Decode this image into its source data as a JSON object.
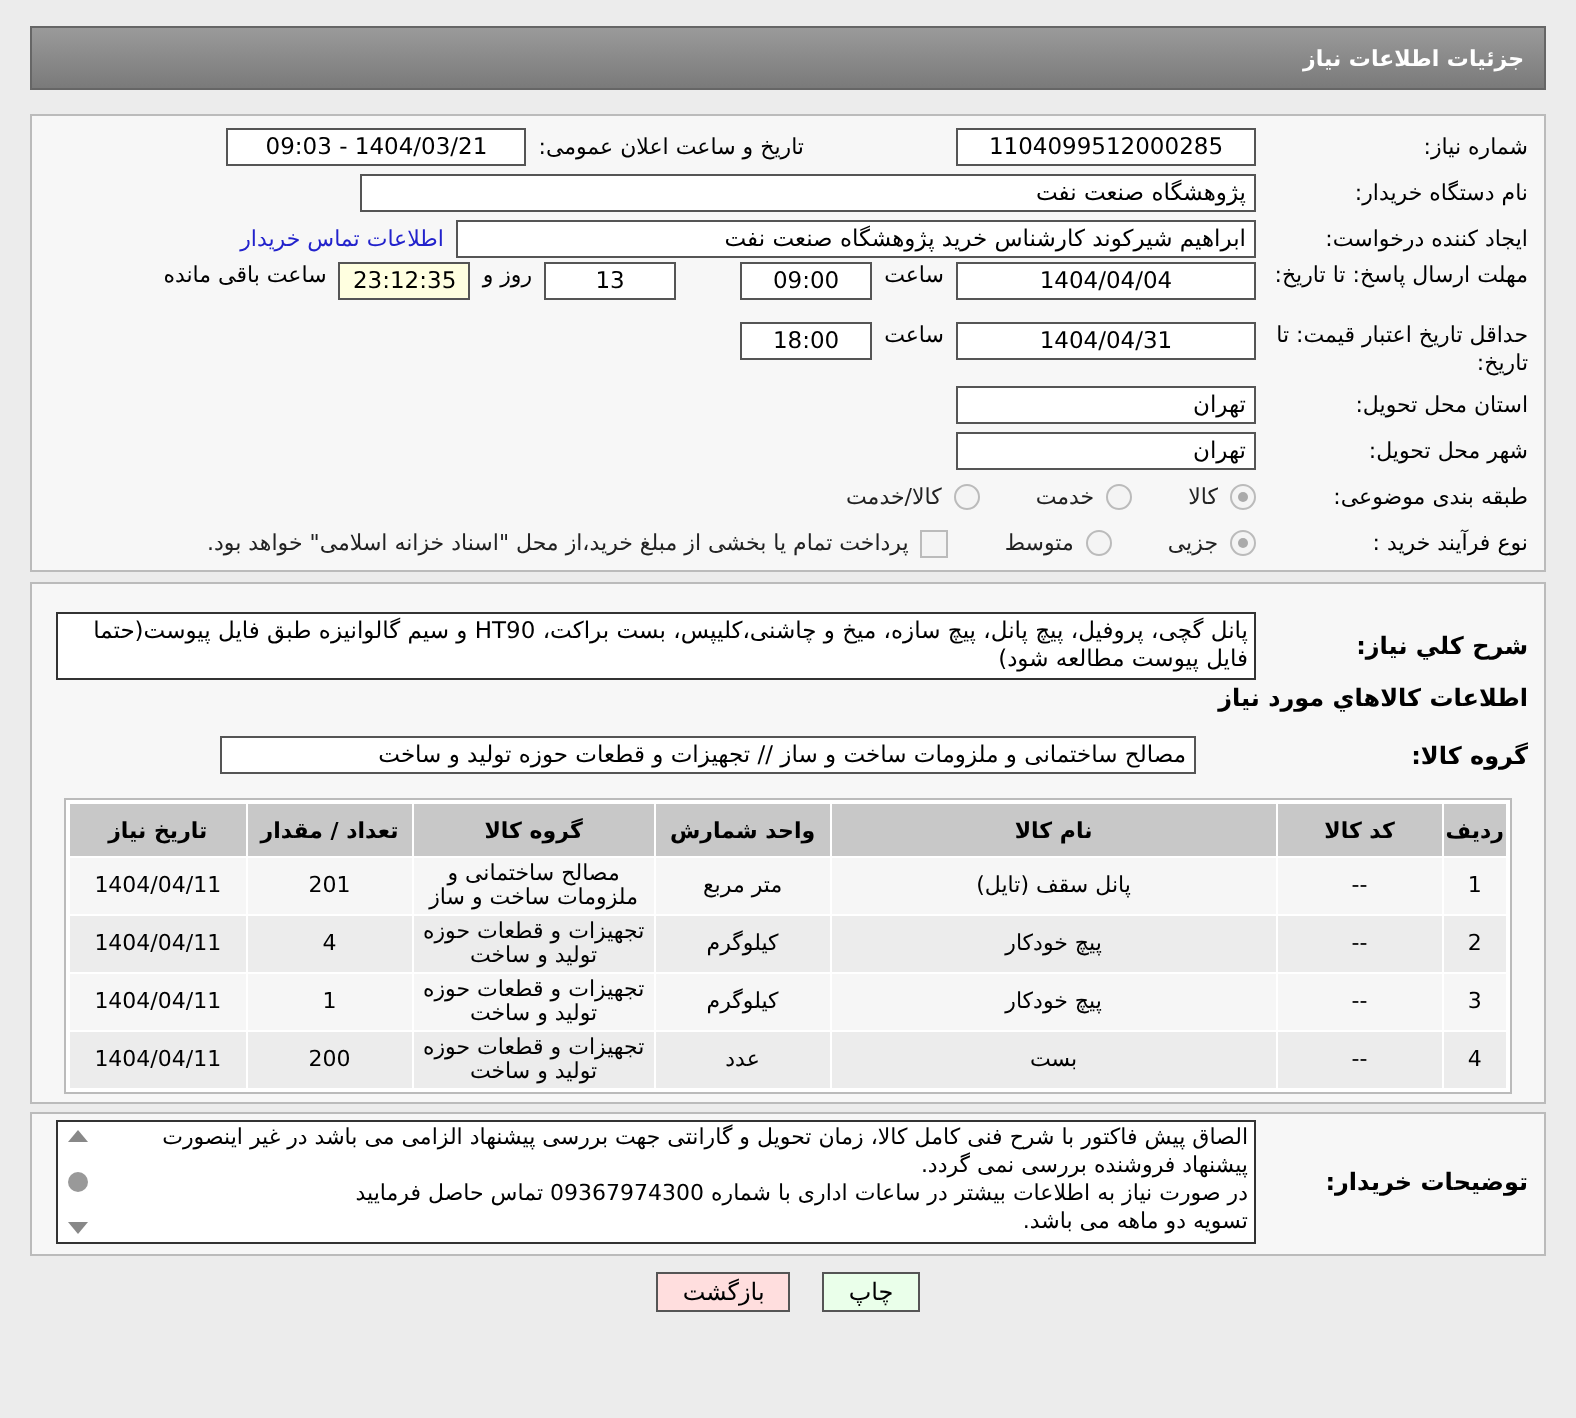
{
  "header": {
    "title": "جزئیات اطلاعات نیاز"
  },
  "need_number": {
    "label": "شماره نیاز:",
    "value": "1104099512000285"
  },
  "announce": {
    "label": "تاریخ و ساعت اعلان عمومی:",
    "value": "1404/03/21 - 09:03"
  },
  "buyer_org": {
    "label": "نام دستگاه خریدار:",
    "value": "پژوهشگاه صنعت نفت"
  },
  "creator": {
    "label": "ایجاد کننده درخواست:",
    "value": "ابراهیم شیرکوند کارشناس خرید پژوهشگاه صنعت نفت",
    "link": "اطلاعات تماس خریدار"
  },
  "reply_deadline": {
    "label": "مهلت ارسال پاسخ: تا تاریخ:",
    "date": "1404/04/04",
    "time_label": "ساعت",
    "time": "09:00",
    "days": "13",
    "days_label": "روز و",
    "remaining": "23:12:35",
    "remaining_label": "ساعت باقی مانده"
  },
  "price_validity": {
    "label": "حداقل تاریخ اعتبار قیمت: تا تاریخ:",
    "date": "1404/04/31",
    "time_label": "ساعت",
    "time": "18:00"
  },
  "province": {
    "label": "استان محل تحویل:",
    "value": "تهران"
  },
  "city": {
    "label": "شهر محل تحویل:",
    "value": "تهران"
  },
  "category": {
    "label": "طبقه بندی موضوعی:",
    "options": [
      {
        "label": "کالا",
        "selected": true
      },
      {
        "label": "خدمت",
        "selected": false
      },
      {
        "label": "کالا/خدمت",
        "selected": false
      }
    ]
  },
  "process": {
    "label": "نوع فرآیند خرید :",
    "options": [
      {
        "label": "جزیی",
        "selected": true
      },
      {
        "label": "متوسط",
        "selected": false
      }
    ],
    "payment_checkbox": {
      "checked": false,
      "label": "پرداخت تمام یا بخشی از مبلغ خرید،از محل \"اسناد خزانه اسلامی\" خواهد بود."
    }
  },
  "description": {
    "label": "شرح كلي نياز:",
    "value": "پانل گچی، پروفیل، پیچ پانل، پیچ سازه، میخ و چاشنی،کلیپس، بست براکت، HT90 و سیم گالوانیزه طبق فایل پیوست(حتما فایل پیوست مطالعه شود)"
  },
  "goods_title": "اطلاعات كالاهاي مورد نياز",
  "goods_group": {
    "label": "گروه كالا:",
    "value": "مصالح ساختمانی و ملزومات ساخت و ساز // تجهیزات و قطعات حوزه تولید و ساخت"
  },
  "table": {
    "columns": [
      "ردیف",
      "کد کالا",
      "نام کالا",
      "واحد شمارش",
      "گروه کالا",
      "تعداد / مقدار",
      "تاریخ نیاز"
    ],
    "rows": [
      [
        "1",
        "--",
        "پانل سقف (تایل)",
        "متر مربع",
        "مصالح ساختمانی و ملزومات ساخت و ساز",
        "201",
        "1404/04/11"
      ],
      [
        "2",
        "--",
        "پیچ خودکار",
        "کیلوگرم",
        "تجهیزات و قطعات حوزه تولید و ساخت",
        "4",
        "1404/04/11"
      ],
      [
        "3",
        "--",
        "پیچ خودکار",
        "کیلوگرم",
        "تجهیزات و قطعات حوزه تولید و ساخت",
        "1",
        "1404/04/11"
      ],
      [
        "4",
        "--",
        "بست",
        "عدد",
        "تجهیزات و قطعات حوزه تولید و ساخت",
        "200",
        "1404/04/11"
      ]
    ]
  },
  "buyer_notes": {
    "label": "توضیحات خریدار:",
    "lines": [
      "الصاق پیش فاکتور با شرح فنی کامل کالا، زمان تحویل و گارانتی جهت بررسی پیشنهاد الزامی می باشد در غیر اینصورت پیشنهاد فروشنده بررسی نمی گردد.",
      "در صورت نیاز به اطلاعات بیشتر در ساعات اداری با شماره 09367974300 تماس حاصل فرمایید",
      "تسویه دو ماهه می باشد."
    ]
  },
  "buttons": [
    {
      "label": "چاپ",
      "kind": "print"
    },
    {
      "label": "بازگشت",
      "kind": "back"
    }
  ]
}
